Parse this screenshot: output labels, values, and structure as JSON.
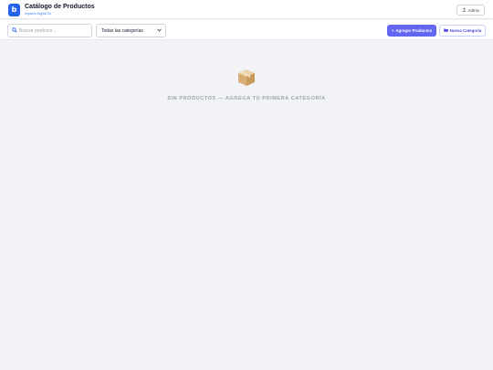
{
  "header": {
    "logo_letter": "b",
    "title": "Catálogo de Productos",
    "subtitle": "Impacto Digital 5V",
    "admin_label": "Admin",
    "admin_icon": "user-icon"
  },
  "toolbar": {
    "search_icon": "search-icon",
    "search_placeholder": "Buscar producto...",
    "category_selected": "Todas las categorías",
    "add_products_label": "Agregar Productos",
    "new_category_label": "Nueva Categoría"
  },
  "empty_state": {
    "icon": "package-icon",
    "message": "SIN PRODUCTOS — AGREGA TU PRIMERA CATEGORÍA"
  },
  "colors": {
    "brand": "#2563eb",
    "accent": "#6366f1",
    "background": "#f1f3f7"
  }
}
